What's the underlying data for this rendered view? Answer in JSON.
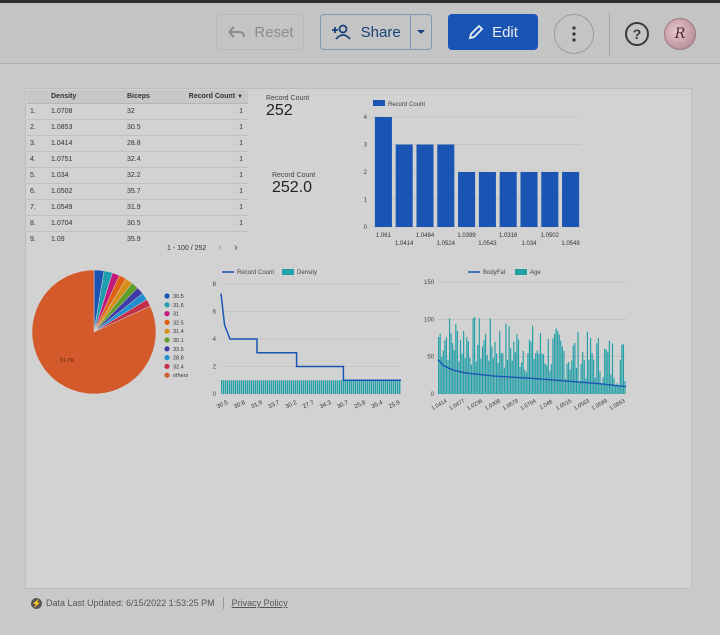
{
  "toolbar": {
    "reset_label": "Reset",
    "share_label": "Share",
    "edit_label": "Edit",
    "avatar_letter": "R",
    "colors": {
      "edit_bg": "#1a55b3",
      "share_text": "#17427a"
    }
  },
  "table": {
    "headers": [
      "Density",
      "Biceps",
      "Record Count"
    ],
    "rows": [
      {
        "idx": "1.",
        "density": "1.0708",
        "biceps": "32",
        "count": "1"
      },
      {
        "idx": "2.",
        "density": "1.0853",
        "biceps": "30.5",
        "count": "1"
      },
      {
        "idx": "3.",
        "density": "1.0414",
        "biceps": "28.8",
        "count": "1"
      },
      {
        "idx": "4.",
        "density": "1.0751",
        "biceps": "32.4",
        "count": "1"
      },
      {
        "idx": "5.",
        "density": "1.034",
        "biceps": "32.2",
        "count": "1"
      },
      {
        "idx": "6.",
        "density": "1.0502",
        "biceps": "35.7",
        "count": "1"
      },
      {
        "idx": "7.",
        "density": "1.0549",
        "biceps": "31.9",
        "count": "1"
      },
      {
        "idx": "8.",
        "density": "1.0704",
        "biceps": "30.5",
        "count": "1"
      },
      {
        "idx": "9.",
        "density": "1.09",
        "biceps": "35.9",
        "count": ""
      }
    ],
    "pager_text": "1 - 100 / 252"
  },
  "scorecards": [
    {
      "label": "Record Count",
      "value": "252"
    },
    {
      "label": "Record Count",
      "value": "252.0"
    }
  ],
  "chart_data": [
    {
      "type": "bar",
      "legend": [
        "Record Count"
      ],
      "categories": [
        "1.061",
        "1.0414",
        "1.0484",
        "1.0524",
        "1.0399",
        "1.0543",
        "1.0316",
        "1.034",
        "1.0502",
        "1.0549"
      ],
      "values": [
        4,
        3,
        3,
        3,
        2,
        2,
        2,
        2,
        2,
        2
      ],
      "ylim": [
        0,
        4
      ],
      "yticks": [
        "0",
        "1",
        "2",
        "3",
        "4"
      ],
      "color": "#1a55b3"
    },
    {
      "type": "pie",
      "legend": [
        "30.5",
        "31.6",
        "31",
        "32.5",
        "31.4",
        "30.1",
        "33.5",
        "28.8",
        "32.4",
        "others"
      ],
      "colors": [
        "#1a55b3",
        "#1e9fb0",
        "#c2187c",
        "#e06010",
        "#d88f1a",
        "#5e9e2a",
        "#3d3aa6",
        "#1f8fd0",
        "#c2304a",
        "#d45a2c"
      ],
      "values": [
        2.6,
        2.2,
        1.9,
        1.9,
        1.9,
        1.9,
        1.9,
        1.9,
        1.9,
        81.7
      ],
      "slice_label": "81.7%"
    },
    {
      "type": "line",
      "legend": [
        "Record Count",
        "Density"
      ],
      "colors": [
        "#1a55b3",
        "#24a0a8"
      ],
      "x_tick_labels": [
        "30.5",
        "30.6",
        "31.9",
        "33.7",
        "30.2",
        "27.7",
        "34.3",
        "30.7",
        "25.8",
        "35.4",
        "25.9"
      ],
      "ylim": [
        0,
        8
      ],
      "yticks": [
        "0",
        "2",
        "4",
        "6",
        "8"
      ],
      "line_steps": [
        [
          0,
          7.3
        ],
        [
          0.02,
          5
        ],
        [
          0.05,
          4
        ],
        [
          0.2,
          4
        ],
        [
          0.2,
          3
        ],
        [
          0.42,
          3
        ],
        [
          0.42,
          2
        ],
        [
          0.68,
          2
        ],
        [
          0.68,
          1
        ],
        [
          1,
          1
        ]
      ],
      "bar_level": 1
    },
    {
      "type": "line",
      "legend": [
        "BodyFat",
        "Age"
      ],
      "colors": [
        "#1a55b3",
        "#24a0a8"
      ],
      "x_tick_labels": [
        "1.0414",
        "1.0477",
        "1.0236",
        "1.0308",
        "1.0678",
        "1.0704",
        "1.048",
        "1.0515",
        "1.0563",
        "1.0599",
        "1.0653"
      ],
      "ylim": [
        0,
        150
      ],
      "yticks": [
        "0",
        "50",
        "100",
        "150"
      ],
      "line_points": [
        [
          0,
          46
        ],
        [
          0.03,
          38
        ],
        [
          0.08,
          32
        ],
        [
          0.15,
          28
        ],
        [
          0.3,
          24
        ],
        [
          0.5,
          21
        ],
        [
          0.7,
          17
        ],
        [
          0.85,
          14
        ],
        [
          1,
          10
        ]
      ]
    }
  ],
  "footer": {
    "updated_text": "Data Last Updated: 6/15/2022 1:53:25 PM",
    "privacy_label": "Privacy Policy"
  }
}
